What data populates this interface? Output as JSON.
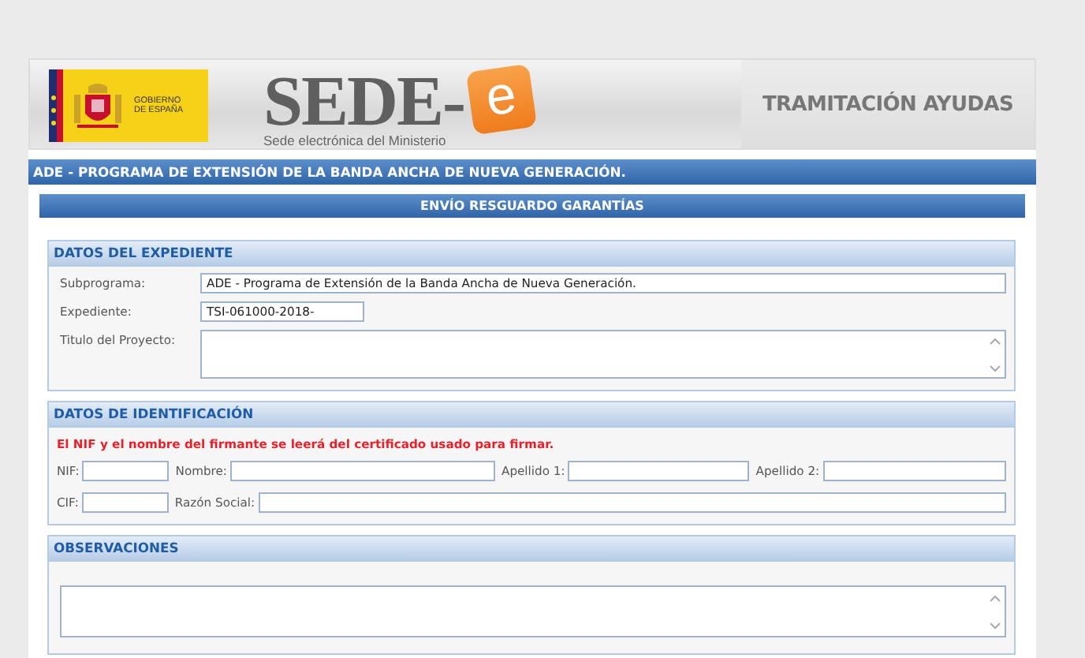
{
  "header": {
    "gov_logo_lines": [
      "GOBIERNO",
      "DE ESPAÑA"
    ],
    "brand": "SEDE-",
    "brand_badge": "e",
    "brand_subtitle": "Sede electrónica del Ministerio",
    "app_title": "TRAMITACIÓN AYUDAS"
  },
  "program_bar": "ADE - PROGRAMA DE EXTENSIÓN DE LA BANDA ANCHA DE NUEVA GENERACIÓN.",
  "form_title": "ENVÍO RESGUARDO GARANTÍAS",
  "sections": [
    {
      "kind": "labeled",
      "title": "DATOS DEL EXPEDIENTE",
      "fields": [
        {
          "kind": "input",
          "label": "Subprograma:",
          "value": "ADE - Programa de Extensión de la Banda Ancha de Nueva Generación."
        },
        {
          "kind": "input",
          "label": "Expediente:",
          "value": "TSI-061000-2018-"
        },
        {
          "kind": "textarea",
          "label": "Titulo del Proyecto:"
        }
      ]
    },
    {
      "kind": "inline",
      "title": "DATOS DE IDENTIFICACIÓN",
      "note": "El NIF y el nombre del firmante se leerá del certificado usado para firmar.",
      "rows": [
        [
          {
            "label": "NIF:"
          },
          {
            "label": "Nombre:"
          },
          {
            "label": "Apellido 1:"
          },
          {
            "label": "Apellido 2:"
          }
        ],
        [
          {
            "label": "CIF:"
          },
          {
            "label": "Razón Social:"
          }
        ]
      ]
    },
    {
      "kind": "textarea",
      "title": "OBSERVACIONES"
    }
  ]
}
